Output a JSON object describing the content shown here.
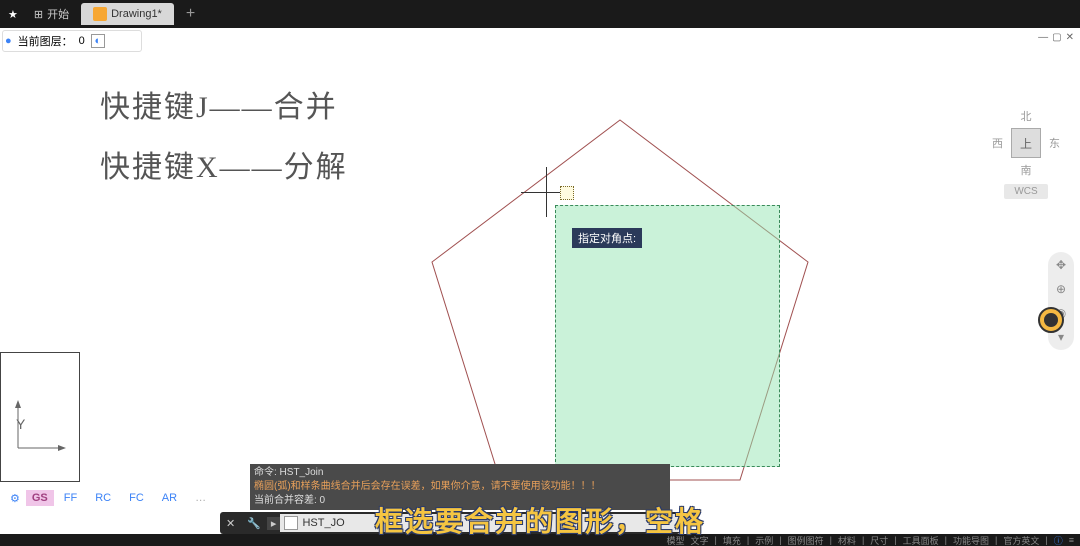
{
  "titlebar": {
    "start_label": "开始",
    "tab_label": "Drawing1*"
  },
  "layer": {
    "current_label": "当前图层：",
    "current_value": "0"
  },
  "handwriting": {
    "line1": "快捷键J——合并",
    "line2": "快捷键X——分解"
  },
  "tooltip": {
    "text": "指定对角点:"
  },
  "navcube": {
    "north": "北",
    "west": "西",
    "top": "上",
    "east": "东",
    "south": "南",
    "wcs": "WCS"
  },
  "cmd": {
    "line1": "命令: HST_Join",
    "line2": "椭圆(弧)和样条曲线合并后会存在误差，如果你介意，请不要使用该功能！！！",
    "line3": "当前合并容差: 0",
    "prompt": "HST_JO"
  },
  "tabs": {
    "model": "模型",
    "gs": "GS",
    "ff": "FF",
    "rc": "RC",
    "fc": "FC",
    "ar": "AR"
  },
  "ucs": {
    "y": "Y"
  },
  "status": {
    "items": [
      "文字",
      "填充",
      "示例",
      "图例图符",
      "材料",
      "尺寸",
      "工具面板",
      "功能导图",
      "官方英文"
    ]
  },
  "subtitle": {
    "text": "框选要合并的图形，空格"
  }
}
